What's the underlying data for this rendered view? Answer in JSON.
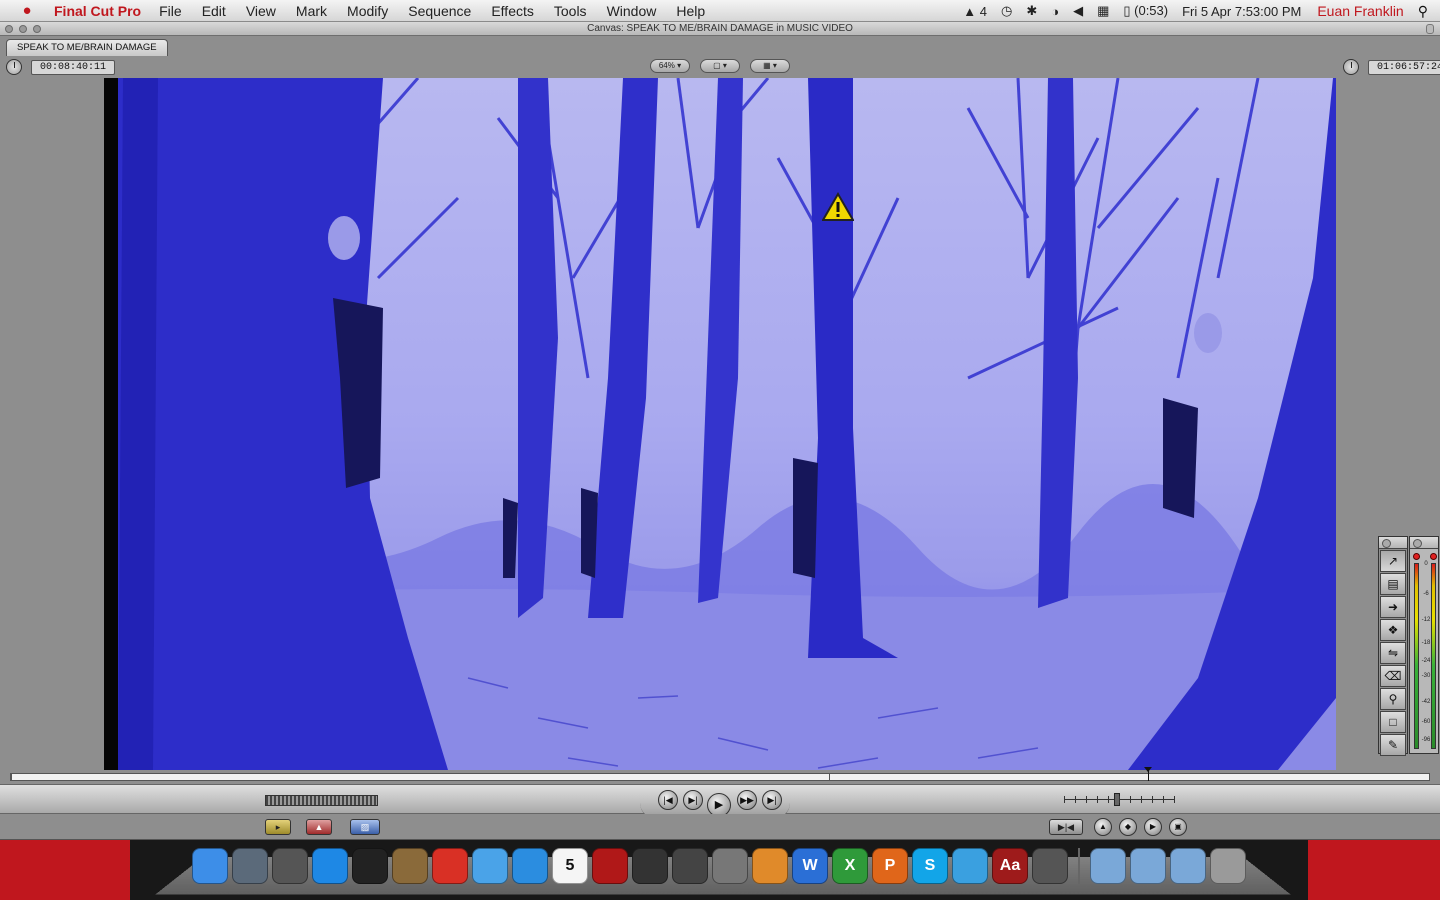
{
  "menubar": {
    "app_name": "Final Cut Pro",
    "menus": [
      "File",
      "Edit",
      "View",
      "Mark",
      "Modify",
      "Sequence",
      "Effects",
      "Tools",
      "Window",
      "Help"
    ],
    "adobe_badge": "4",
    "battery": "(0:53)",
    "clock": "Fri 5 Apr  7:53:00 PM",
    "user": "Euan Franklin"
  },
  "window": {
    "title": "Canvas: SPEAK TO ME/BRAIN DAMAGE in MUSIC VIDEO",
    "tab": "SPEAK TO ME/BRAIN DAMAGE"
  },
  "controls": {
    "duration_timecode": "00:08:40:11",
    "current_timecode": "01:06:57:24",
    "zoom_popup": "64%",
    "view_popup": "",
    "overlay_popup": ""
  },
  "video": {
    "tint_color": "#3c3cf0",
    "warning_icon": "render-warning-icon"
  },
  "audio_meter_labels": [
    "0",
    "-6",
    "-12",
    "-18",
    "-24",
    "-30",
    "-42",
    "-60",
    "-96"
  ],
  "tools": [
    "selection-tool",
    "track-select-tool",
    "ripple-tool",
    "razor-tool",
    "slip-tool",
    "pen-tool-alt",
    "zoom-tool",
    "crop-tool",
    "pen-tool"
  ],
  "dock": [
    {
      "name": "finder",
      "color": "#3d8ee8",
      "glyph": ""
    },
    {
      "name": "dashboard",
      "color": "#5b6a7a",
      "glyph": ""
    },
    {
      "name": "launchpad",
      "color": "#555",
      "glyph": ""
    },
    {
      "name": "app-store",
      "color": "#1e88e5",
      "glyph": ""
    },
    {
      "name": "mission-control",
      "color": "#222",
      "glyph": ""
    },
    {
      "name": "preview",
      "color": "#8a6a3a",
      "glyph": ""
    },
    {
      "name": "chrome",
      "color": "#d93025",
      "glyph": ""
    },
    {
      "name": "safari",
      "color": "#4aa3e8",
      "glyph": ""
    },
    {
      "name": "itunes",
      "color": "#2b8de0",
      "glyph": ""
    },
    {
      "name": "ical",
      "color": "#f5f5f5",
      "glyph": "5"
    },
    {
      "name": "photo-booth",
      "color": "#b01818",
      "glyph": ""
    },
    {
      "name": "final-cut-pro",
      "color": "#333",
      "glyph": ""
    },
    {
      "name": "color",
      "color": "#444",
      "glyph": ""
    },
    {
      "name": "compressor",
      "color": "#777",
      "glyph": ""
    },
    {
      "name": "pages",
      "color": "#e08a2a",
      "glyph": ""
    },
    {
      "name": "word",
      "color": "#2b6fd6",
      "glyph": "W"
    },
    {
      "name": "excel",
      "color": "#2f9a3a",
      "glyph": "X"
    },
    {
      "name": "powerpoint",
      "color": "#e0661a",
      "glyph": "P"
    },
    {
      "name": "skype",
      "color": "#12a5e8",
      "glyph": "S"
    },
    {
      "name": "twitter",
      "color": "#3aa0e0",
      "glyph": ""
    },
    {
      "name": "dictionary",
      "color": "#9e1b1b",
      "glyph": "Aa"
    },
    {
      "name": "facetime",
      "color": "#555",
      "glyph": ""
    },
    {
      "name": "applications-folder",
      "color": "#7aa8d8",
      "glyph": ""
    },
    {
      "name": "downloads-folder",
      "color": "#7aa8d8",
      "glyph": ""
    },
    {
      "name": "documents-folder",
      "color": "#7aa8d8",
      "glyph": ""
    },
    {
      "name": "trash",
      "color": "#9a9a9a",
      "glyph": ""
    }
  ]
}
